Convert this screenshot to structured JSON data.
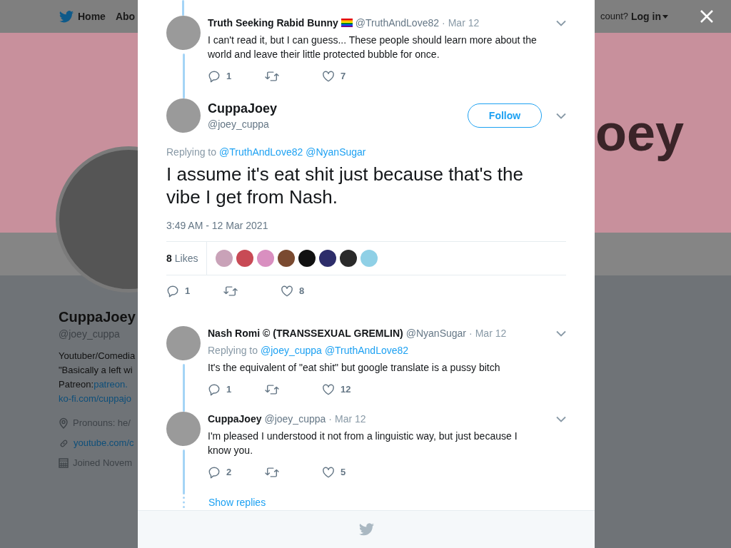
{
  "nav": {
    "items": [
      {
        "label": "Home"
      },
      {
        "label": "Abo"
      }
    ],
    "account_prompt": "count?",
    "login": "Log in"
  },
  "banner": {
    "text": "oey"
  },
  "profile": {
    "name": "CuppaJoey",
    "handle": "@joey_cuppa",
    "bio": [
      {
        "text": "Youtuber/Comedia"
      },
      {
        "text": "\"Basically a left wi"
      },
      {
        "text": "Patreon: ",
        "link": "patreon."
      },
      {
        "link": "ko-fi.com/cuppajo"
      }
    ],
    "meta": [
      {
        "kind": "location",
        "text": "Pronouns: he/"
      },
      {
        "kind": "link",
        "text": "youtube.com/c"
      },
      {
        "kind": "joined",
        "text": "Joined Novem"
      }
    ]
  },
  "modal": {
    "tweets": [
      {
        "kind": "reply",
        "name": "Truth Seeking Rabid Bunny",
        "flag": true,
        "handle": "@TruthAndLove82",
        "separator": "·",
        "date": "Mar 12",
        "text": "I can't read it, but I can guess... These people should learn more about the world and leave their little protected bubble for once.",
        "replies": "1",
        "likes": "7"
      },
      {
        "kind": "focus",
        "name": "CuppaJoey",
        "handle": "@joey_cuppa",
        "follow": "Follow",
        "replying_label": "Replying to",
        "replying_to": [
          "@TruthAndLove82",
          "@NyanSugar"
        ],
        "text": "I assume it's eat shit just because that's the vibe I get from Nash.",
        "time": "3:49 AM - 12 Mar 2021",
        "likes_count": "8",
        "likes_label": "Likes",
        "likers": [
          {
            "color": "#c9a2b8"
          },
          {
            "color": "#c84a55"
          },
          {
            "color": "#d98fc0"
          },
          {
            "color": "#7a4a30"
          },
          {
            "color": "#111111"
          },
          {
            "color": "#2d2d6a"
          },
          {
            "color": "#2a2a2a"
          },
          {
            "color": "#8fd0e6"
          }
        ],
        "replies": "1",
        "likes": "8"
      },
      {
        "kind": "reply",
        "name": "Nash Romi © (TRANSSEXUAL GREMLIN)",
        "handle": "@NyanSugar",
        "separator": "·",
        "date": "Mar 12",
        "replying_label": "Replying to",
        "replying_to": [
          "@joey_cuppa",
          "@TruthAndLove82"
        ],
        "text": "It's the equivalent of \"eat shit\" but google translate is a pussy bitch",
        "replies": "1",
        "likes": "12"
      },
      {
        "kind": "reply",
        "name": "CuppaJoey",
        "handle": "@joey_cuppa",
        "separator": "·",
        "date": "Mar 12",
        "text": "I'm pleased I understood it not from a linguistic way, but just because I know you.",
        "replies": "2",
        "likes": "5"
      }
    ],
    "show_replies": "Show replies"
  }
}
